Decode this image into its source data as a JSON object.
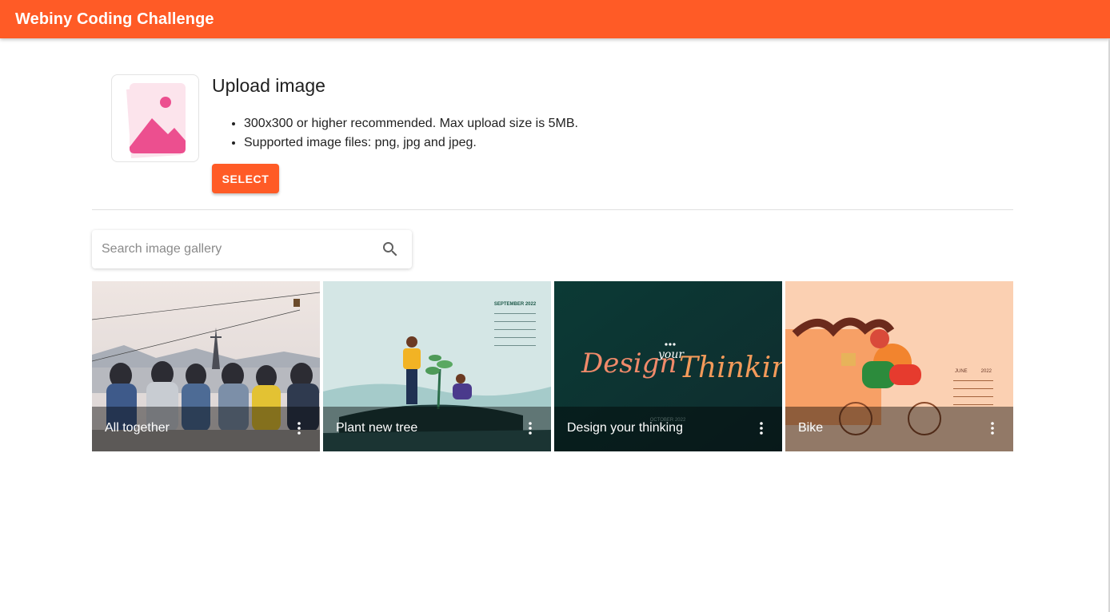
{
  "appbar": {
    "title": "Webiny Coding Challenge"
  },
  "upload": {
    "title": "Upload image",
    "hints": [
      "300x300 or higher recommended. Max upload size is 5MB.",
      "Supported image files: png, jpg and jpeg."
    ],
    "select_label": "SELECT"
  },
  "search": {
    "placeholder": "Search image gallery",
    "value": ""
  },
  "gallery": [
    {
      "title": "All together",
      "icon": "more-vert-icon"
    },
    {
      "title": "Plant new tree",
      "icon": "more-vert-icon"
    },
    {
      "title": "Design your thinking",
      "icon": "more-vert-icon"
    },
    {
      "title": "Bike",
      "icon": "more-vert-icon"
    }
  ],
  "artwork_text": {
    "tree_calendar": "SEPTEMBER 2022",
    "design_script_1": "Design",
    "design_script_2": "your",
    "design_script_3": "Thinking",
    "design_calendar": "OCTOBER 2022",
    "bike_calendar_month": "JUNE",
    "bike_calendar_year": "2022"
  },
  "colors": {
    "accent": "#ff5b26",
    "image_placeholder": "#ec4f8f"
  }
}
